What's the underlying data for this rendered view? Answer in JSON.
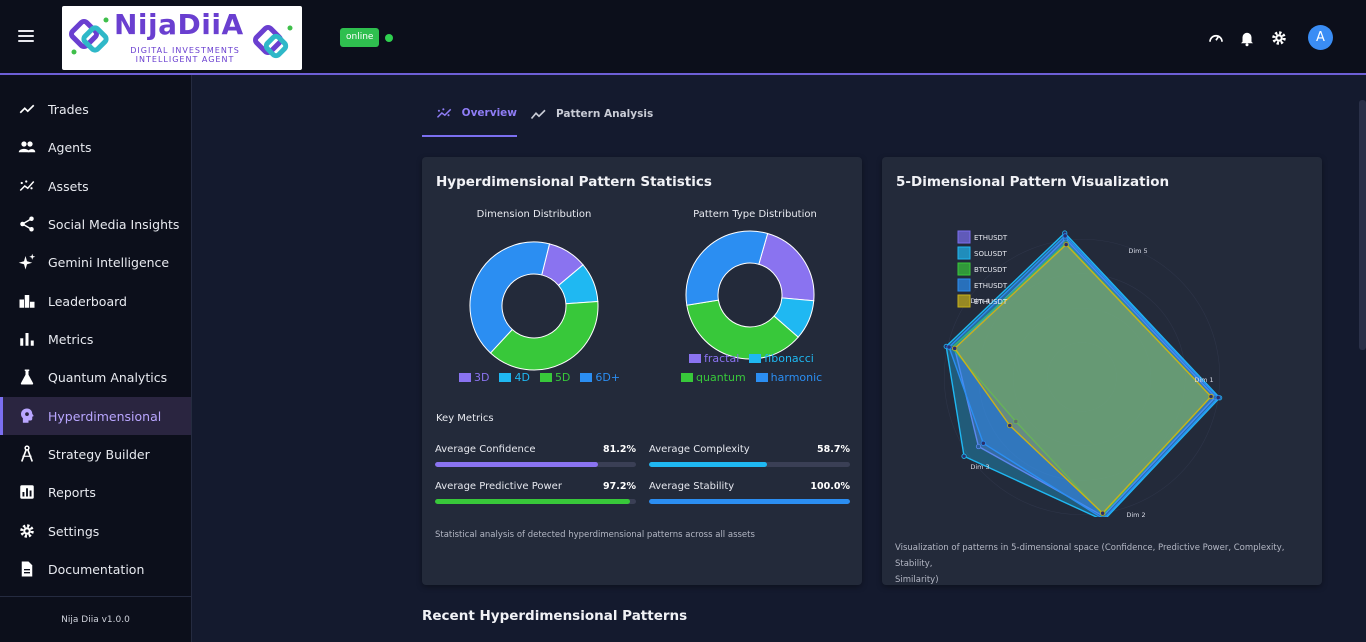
{
  "header": {
    "logo_title": "NijaDiiA",
    "logo_sub1": "DIGITAL INVESTMENTS",
    "logo_sub2": "INTELLIGENT AGENT",
    "status_label": "online",
    "avatar_initial": "A",
    "icons": [
      "speedometer-icon",
      "bell-icon",
      "gear-icon"
    ]
  },
  "sidebar": {
    "items": [
      {
        "label": "Trades",
        "icon": "trend-line-icon"
      },
      {
        "label": "Agents",
        "icon": "people-icon"
      },
      {
        "label": "Assets",
        "icon": "scatter-trend-icon"
      },
      {
        "label": "Social Media Insights",
        "icon": "share-icon"
      },
      {
        "label": "Gemini Intelligence",
        "icon": "sparkle-icon"
      },
      {
        "label": "Leaderboard",
        "icon": "leaderboard-icon"
      },
      {
        "label": "Metrics",
        "icon": "bar-chart-icon"
      },
      {
        "label": "Quantum Analytics",
        "icon": "flask-icon"
      },
      {
        "label": "Hyperdimensional",
        "icon": "brain-icon",
        "active": true
      },
      {
        "label": "Strategy Builder",
        "icon": "compass-icon"
      },
      {
        "label": "Reports",
        "icon": "report-icon"
      },
      {
        "label": "Settings",
        "icon": "gear-icon"
      },
      {
        "label": "Documentation",
        "icon": "document-icon"
      }
    ],
    "footer": "Nija Diia v1.0.0"
  },
  "tabs": [
    {
      "label": "Overview",
      "active": true
    },
    {
      "label": "Pattern Analysis",
      "active": false
    }
  ],
  "stats_card": {
    "title": "Hyperdimensional Pattern Statistics",
    "dimension_title": "Dimension Distribution",
    "pattern_title": "Pattern Type Distribution",
    "key_metrics_title": "Key Metrics",
    "caption": "Statistical analysis of detected hyperdimensional patterns across all assets",
    "metrics": [
      {
        "label": "Average Confidence",
        "value": "81.2%",
        "fraction": 0.812,
        "color": "#8a73f0"
      },
      {
        "label": "Average Complexity",
        "value": "58.7%",
        "fraction": 0.587,
        "color": "#1fb8f2"
      },
      {
        "label": "Average Predictive Power",
        "value": "97.2%",
        "fraction": 0.972,
        "color": "#38c83a"
      },
      {
        "label": "Average Stability",
        "value": "100.0%",
        "fraction": 1.0,
        "color": "#2b8ef2"
      }
    ]
  },
  "viz_card": {
    "title": "5-Dimensional Pattern Visualization",
    "caption_line1": "Visualization of patterns in 5-dimensional space (Confidence, Predictive Power, Complexity, Stability,",
    "caption_line2": "Similarity)"
  },
  "bottom": {
    "title": "Recent Hyperdimensional Patterns"
  },
  "chart_data": [
    {
      "type": "pie",
      "title": "Dimension Distribution",
      "categories": [
        "3D",
        "4D",
        "5D",
        "6D+"
      ],
      "values": [
        10,
        10,
        38,
        42
      ],
      "colors": [
        "#8a73f0",
        "#1fb8f2",
        "#38c83a",
        "#2b8ef2"
      ],
      "legend": "bottom"
    },
    {
      "type": "pie",
      "title": "Pattern Type Distribution",
      "categories": [
        "fractal",
        "fibonacci",
        "quantum",
        "harmonic"
      ],
      "values": [
        22,
        10,
        36,
        32
      ],
      "colors": [
        "#8a73f0",
        "#1fb8f2",
        "#38c83a",
        "#2b8ef2"
      ],
      "legend": "bottom"
    },
    {
      "type": "radar",
      "title": "",
      "axes": [
        "Dim 1",
        "Dim 2",
        "Dim 3",
        "Dim 4",
        "Dim 5"
      ],
      "rmax": 1.0,
      "legend": "top-left",
      "series": [
        {
          "name": "ETHUSDT",
          "values": [
            0.93,
            0.97,
            0.86,
            0.9,
            0.96
          ],
          "color": "#7b6ff0"
        },
        {
          "name": "SOLUSDT",
          "values": [
            0.96,
            1.0,
            0.98,
            0.96,
            1.0
          ],
          "color": "#1fb8f2"
        },
        {
          "name": "BTCUSDT",
          "values": [
            0.9,
            0.96,
            0.55,
            0.92,
            0.93
          ],
          "color": "#38c83a"
        },
        {
          "name": "ETHUSDT",
          "values": [
            0.95,
            0.99,
            0.82,
            0.94,
            0.98
          ],
          "color": "#2b8ef2"
        },
        {
          "name": "ETHUSDT",
          "values": [
            0.9,
            0.95,
            0.6,
            0.9,
            0.92
          ],
          "color": "#c9b21a"
        }
      ]
    }
  ]
}
